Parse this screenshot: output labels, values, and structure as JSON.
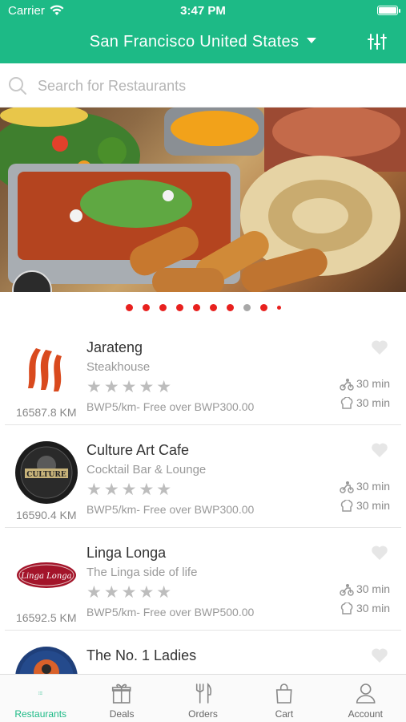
{
  "status_bar": {
    "carrier": "Carrier",
    "time": "3:47 PM"
  },
  "header": {
    "location": "San Francisco United States"
  },
  "search": {
    "placeholder": "Search for Restaurants"
  },
  "carousel": {
    "total": 10,
    "active_index": 7
  },
  "restaurants": [
    {
      "name": "Jarateng",
      "cuisine": "Steakhouse",
      "rating": "★★★★★",
      "fee": "BWP5/km- Free over BWP300.00",
      "distance": "16587.8 KM",
      "delivery_time": "30 min",
      "prep_time": "30 min"
    },
    {
      "name": "Culture Art Cafe",
      "cuisine": "Cocktail Bar & Lounge",
      "rating": "★★★★★",
      "fee": "BWP5/km- Free over BWP300.00",
      "distance": "16590.4 KM",
      "delivery_time": "30 min",
      "prep_time": "30 min"
    },
    {
      "name": "Linga Longa",
      "cuisine": "The Linga side of life",
      "rating": "★★★★★",
      "fee": "BWP5/km- Free over BWP500.00",
      "distance": "16592.5 KM",
      "delivery_time": "30 min",
      "prep_time": "30 min"
    },
    {
      "name": "The No. 1 Ladies",
      "cuisine": ""
    }
  ],
  "logo_text": {
    "culture": "CULTURE",
    "linga": "Linga Longa"
  },
  "tabs": [
    {
      "label": "Restaurants",
      "icon": "list-icon",
      "active": true
    },
    {
      "label": "Deals",
      "icon": "gift-icon"
    },
    {
      "label": "Orders",
      "icon": "utensils-icon"
    },
    {
      "label": "Cart",
      "icon": "bag-icon"
    },
    {
      "label": "Account",
      "icon": "person-icon"
    }
  ],
  "colors": {
    "brand": "#1dba86",
    "dot_active": "#e8201e",
    "dot_inactive": "#a8a8a8"
  }
}
